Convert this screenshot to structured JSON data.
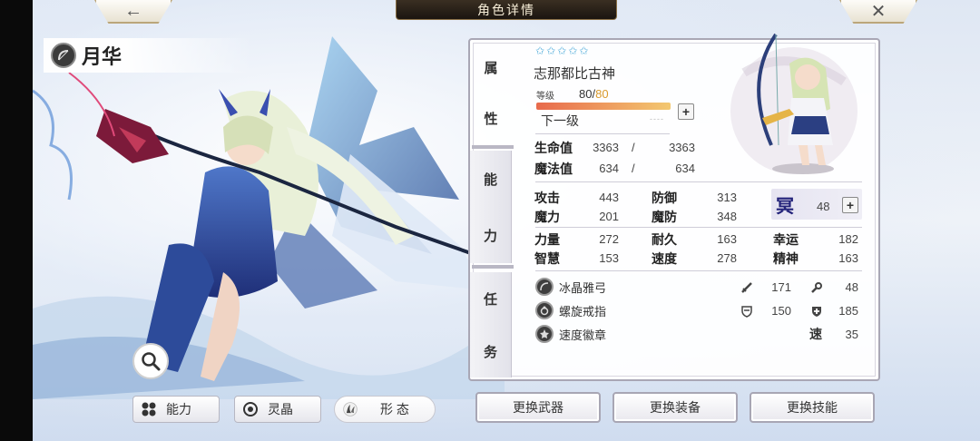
{
  "header": {
    "title": "角色详情",
    "back_glyph": "←",
    "close_glyph": "✕"
  },
  "character": {
    "name": "月华",
    "full_name": "志那都比古神",
    "stars": 5,
    "level_label": "等级",
    "level": "80",
    "level_sep": "/",
    "level_max": "80",
    "level_progress": 1.0,
    "next_label": "下一级",
    "next_value": "----"
  },
  "side_tabs": {
    "attr": [
      "属",
      "性"
    ],
    "ability": [
      "能",
      "力"
    ],
    "quest": [
      "任",
      "务"
    ]
  },
  "vitals": {
    "hp_label": "生命值",
    "hp": "3363",
    "hp_max": "3363",
    "mp_label": "魔法值",
    "mp": "634",
    "mp_max": "634",
    "sep": "/"
  },
  "stats": [
    {
      "label": "攻击",
      "value": "443"
    },
    {
      "label": "防御",
      "value": "313"
    },
    {
      "label": "魔力",
      "value": "201"
    },
    {
      "label": "魔防",
      "value": "348"
    },
    {
      "label": "力量",
      "value": "272"
    },
    {
      "label": "耐久",
      "value": "163"
    },
    {
      "label": "幸运",
      "value": "182"
    },
    {
      "label": "智慧",
      "value": "153"
    },
    {
      "label": "速度",
      "value": "278"
    },
    {
      "label": "精神",
      "value": "163"
    }
  ],
  "badge": {
    "glyph": "冥",
    "value": "48"
  },
  "equipment": [
    {
      "name": "冰晶雅弓",
      "icon": "bow-icon",
      "stats": [
        {
          "icon": "sword-icon",
          "value": "171"
        },
        {
          "icon": "staff-icon",
          "value": "48"
        }
      ]
    },
    {
      "name": "螺旋戒指",
      "icon": "ring-icon",
      "stats": [
        {
          "icon": "shield-icon",
          "value": "150"
        },
        {
          "icon": "cross-shield-icon",
          "value": "185"
        }
      ]
    },
    {
      "name": "速度徽章",
      "icon": "badge-icon",
      "stats": [
        {
          "icon": "speed-text",
          "glyph": "速",
          "value": "35"
        }
      ]
    }
  ],
  "bottom_tabs": {
    "ability": "能力",
    "crystal": "灵晶",
    "form": "形 态"
  },
  "actions": {
    "weapon": "更换武器",
    "equip": "更换装备",
    "skill": "更换技能"
  },
  "colors": {
    "accent_gold": "#d99a2c",
    "star_blue": "#4aa9d8",
    "panel_border": "#a9a7b5"
  }
}
